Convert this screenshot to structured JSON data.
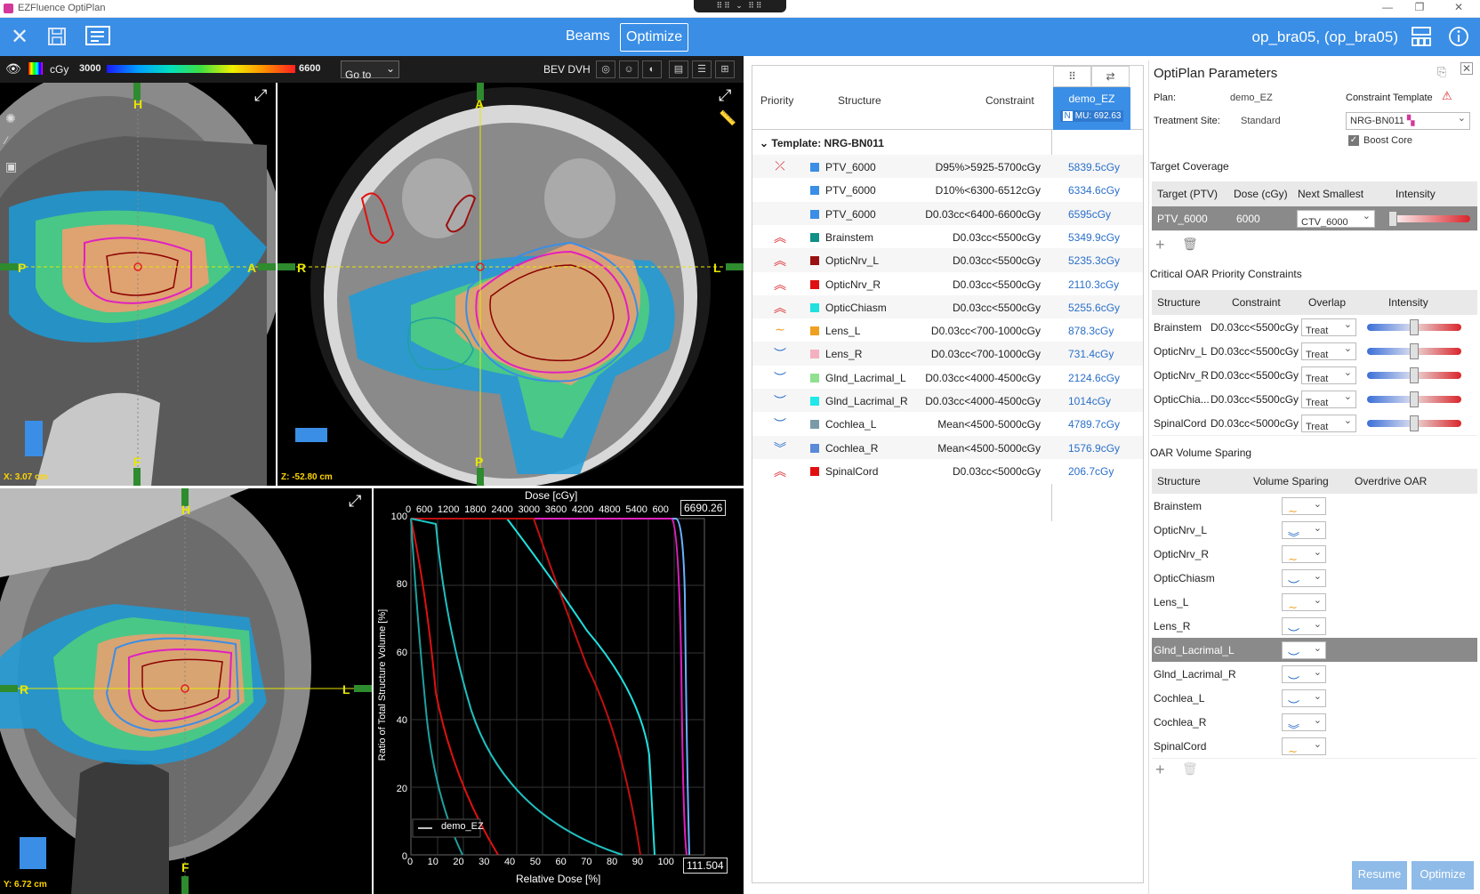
{
  "titlebar": {
    "app_title": "EZFluence OptiPlan",
    "notch_label": "⠿⠿ ⌄ ⠿⠿",
    "min": "—",
    "restore": "❐",
    "close": "✕"
  },
  "toolbar": {
    "beams": "Beams",
    "optimize": "Optimize",
    "plan_title": "op_bra05,  (op_bra05)"
  },
  "viewer_bar": {
    "unit": "cGy",
    "min_dose": "3000",
    "max_dose": "6600",
    "goto": "Go to",
    "bev_dvh": "BEV DVH"
  },
  "sagittal": {
    "top": "H",
    "bottom": "F",
    "left": "P",
    "right": "A",
    "coord": "X: 3.07 cm"
  },
  "axial": {
    "top": "A",
    "bottom": "P",
    "left": "R",
    "right": "L",
    "coord": "Z: -52.80 cm"
  },
  "coronal": {
    "top": "H",
    "bottom": "F",
    "left": "R",
    "right": "L",
    "coord": "Y: 6.72 cm"
  },
  "dvh": {
    "top_label": "Dose [cGy]",
    "top_ticks": [
      "0",
      "600",
      "1200",
      "1800",
      "2400",
      "3000",
      "3600",
      "4200",
      "4800",
      "5400",
      "600"
    ],
    "top_readout": "6690.26",
    "bottom_label": "Relative Dose [%]",
    "bottom_ticks": [
      "0",
      "10",
      "20",
      "30",
      "40",
      "50",
      "60",
      "70",
      "80",
      "90",
      "100"
    ],
    "bottom_readout": "111.504",
    "y_label": "Ratio of Total Structure Volume [%]",
    "y_ticks": [
      "0",
      "20",
      "40",
      "60",
      "80",
      "100"
    ],
    "legend": "demo_EZ"
  },
  "constraints": {
    "headers": {
      "priority": "Priority",
      "structure": "Structure",
      "constraint": "Constraint"
    },
    "plan_col": {
      "name": "demo_EZ",
      "badge": "N",
      "mu": "MU: 692.63"
    },
    "template": "Template: NRG-BN011",
    "rows": [
      {
        "priority": "⤫",
        "color": "#3a8ee6",
        "structure": "PTV_6000",
        "constraint": "D95%>5925-5700cGy",
        "value": "5839.5cGy"
      },
      {
        "priority": "",
        "color": "#3a8ee6",
        "structure": "PTV_6000",
        "constraint": "D10%<6300-6512cGy",
        "value": "6334.6cGy"
      },
      {
        "priority": "",
        "color": "#3a8ee6",
        "structure": "PTV_6000",
        "constraint": "D0.03cc<6400-6600cGy",
        "value": "6595cGy"
      },
      {
        "priority": "︽",
        "color": "#0f8f86",
        "structure": "Brainstem",
        "constraint": "D0.03cc<5500cGy",
        "value": "5349.9cGy"
      },
      {
        "priority": "︽",
        "color": "#9b1010",
        "structure": "OpticNrv_L",
        "constraint": "D0.03cc<5500cGy",
        "value": "5235.3cGy"
      },
      {
        "priority": "︽",
        "color": "#e01010",
        "structure": "OpticNrv_R",
        "constraint": "D0.03cc<5500cGy",
        "value": "2110.3cGy"
      },
      {
        "priority": "︽",
        "color": "#20e0e0",
        "structure": "OpticChiasm",
        "constraint": "D0.03cc<5500cGy",
        "value": "5255.6cGy"
      },
      {
        "priority": "∼",
        "color": "#f0a020",
        "structure": "Lens_L",
        "constraint": "D0.03cc<700-1000cGy",
        "value": "878.3cGy"
      },
      {
        "priority": "︶",
        "color": "#f4b0c0",
        "structure": "Lens_R",
        "constraint": "D0.03cc<700-1000cGy",
        "value": "731.4cGy"
      },
      {
        "priority": "︶",
        "color": "#90e090",
        "structure": "Glnd_Lacrimal_L",
        "constraint": "D0.03cc<4000-4500cGy",
        "value": "2124.6cGy"
      },
      {
        "priority": "︶",
        "color": "#20e8e8",
        "structure": "Glnd_Lacrimal_R",
        "constraint": "D0.03cc<4000-4500cGy",
        "value": "1014cGy"
      },
      {
        "priority": "︶",
        "color": "#7a9aa8",
        "structure": "Cochlea_L",
        "constraint": "Mean<4500-5000cGy",
        "value": "4789.7cGy"
      },
      {
        "priority": "︾",
        "color": "#5a8ad8",
        "structure": "Cochlea_R",
        "constraint": "Mean<4500-5000cGy",
        "value": "1576.9cGy"
      },
      {
        "priority": "︽",
        "color": "#e01010",
        "structure": "SpinalCord",
        "constraint": "D0.03cc<5000cGy",
        "value": "206.7cGy"
      }
    ]
  },
  "params": {
    "title": "OptiPlan Parameters",
    "plan_label": "Plan:",
    "plan_value": "demo_EZ",
    "site_label": "Treatment Site:",
    "site_value": "Standard",
    "template_label": "Constraint Template",
    "template_value": "NRG-BN011",
    "boost": "Boost Core",
    "target_title": "Target Coverage",
    "target_headers": [
      "Target (PTV)",
      "Dose (cGy)",
      "Next Smallest",
      "Intensity"
    ],
    "target_row": {
      "ptv": "PTV_6000",
      "dose": "6000",
      "next": "CTV_6000"
    },
    "oar_title": "Critical OAR Priority Constraints",
    "oar_headers": [
      "Structure",
      "Constraint",
      "Overlap",
      "Intensity"
    ],
    "oar_rows": [
      {
        "structure": "Brainstem",
        "constraint": "D0.03cc<5500cGy",
        "overlap": "Treat",
        "intensity": 0.5
      },
      {
        "structure": "OpticNrv_L",
        "constraint": "D0.03cc<5500cGy",
        "overlap": "Treat",
        "intensity": 0.5
      },
      {
        "structure": "OpticNrv_R",
        "constraint": "D0.03cc<5500cGy",
        "overlap": "Treat",
        "intensity": 0.5
      },
      {
        "structure": "OpticChia...",
        "constraint": "D0.03cc<5500cGy",
        "overlap": "Treat",
        "intensity": 0.5
      },
      {
        "structure": "SpinalCord",
        "constraint": "D0.03cc<5000cGy",
        "overlap": "Treat",
        "intensity": 0.5
      }
    ],
    "vs_title": "OAR Volume Sparing",
    "vs_headers": [
      "Structure",
      "Volume Sparing",
      "Overdrive OAR"
    ],
    "vs_rows": [
      {
        "structure": "Brainstem",
        "icon": "∼"
      },
      {
        "structure": "OpticNrv_L",
        "icon": "︾"
      },
      {
        "structure": "OpticNrv_R",
        "icon": "∼"
      },
      {
        "structure": "OpticChiasm",
        "icon": "︶"
      },
      {
        "structure": "Lens_L",
        "icon": "∼"
      },
      {
        "structure": "Lens_R",
        "icon": "︶"
      },
      {
        "structure": "Glnd_Lacrimal_L",
        "icon": "︶"
      },
      {
        "structure": "Glnd_Lacrimal_R",
        "icon": "︶"
      },
      {
        "structure": "Cochlea_L",
        "icon": "︶"
      },
      {
        "structure": "Cochlea_R",
        "icon": "︾"
      },
      {
        "structure": "SpinalCord",
        "icon": "∼"
      }
    ],
    "resume": "Resume",
    "optimize": "Optimize"
  },
  "colors": {
    "accent": "#3a8ee6",
    "priority_red": "#d9262c",
    "dose_blue": "#2a6fc9"
  }
}
